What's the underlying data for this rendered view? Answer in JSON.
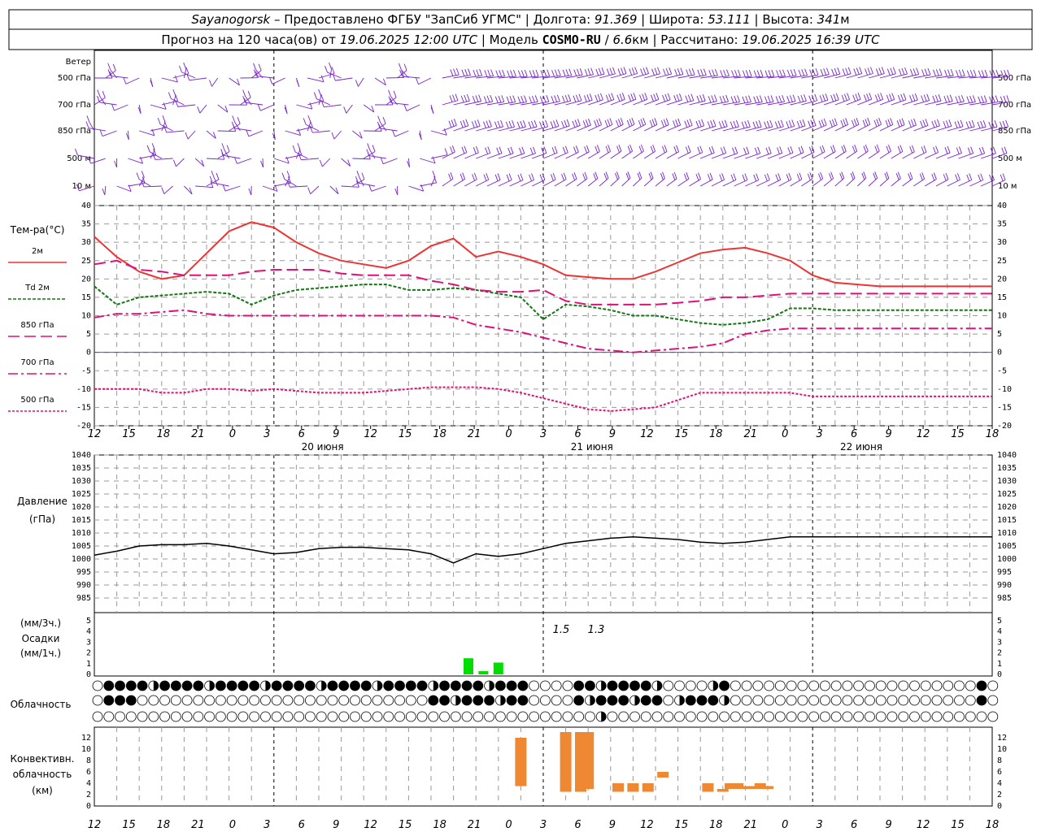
{
  "header": {
    "row1": [
      {
        "text": "Sayanogorsk",
        "style": "italic"
      },
      {
        "text": " – Предоставлено ФГБУ \"ЗапСиб УГМС\" | Долгота: ",
        "style": "normal"
      },
      {
        "text": "91.369",
        "style": "italic"
      },
      {
        "text": " | Широта: ",
        "style": "normal"
      },
      {
        "text": "53.111",
        "style": "italic"
      },
      {
        "text": " | Высота: ",
        "style": "normal"
      },
      {
        "text": "341",
        "style": "italic"
      },
      {
        "text": "м",
        "style": "normal"
      }
    ],
    "row2": [
      {
        "text": "Прогноз на 120 часа(ов) от ",
        "style": "normal"
      },
      {
        "text": "19.06.2025 12:00 UTC",
        "style": "italic"
      },
      {
        "text": "  | Модель ",
        "style": "normal"
      },
      {
        "text": "COSMO-RU",
        "style": "bold"
      },
      {
        "text": " / ",
        "style": "normal"
      },
      {
        "text": "6.6",
        "style": "italic"
      },
      {
        "text": "км | Рассчитано: ",
        "style": "normal"
      },
      {
        "text": "19.06.2025 16:39 UTC",
        "style": "italic"
      }
    ]
  },
  "hour_ticks": [
    "12",
    "15",
    "18",
    "21",
    "0",
    "3",
    "6",
    "9",
    "12",
    "15",
    "18",
    "21",
    "0",
    "3",
    "6",
    "9",
    "12",
    "15",
    "18",
    "21",
    "0",
    "3",
    "6",
    "9",
    "12",
    "15",
    "18"
  ],
  "day_labels": [
    "20 июня",
    "21 июня",
    "22 июня"
  ],
  "wind_panel": {
    "title": "Ветер",
    "levels": [
      "500 гПа",
      "700 гПа",
      "850 гПа",
      "500 м",
      "10 м"
    ],
    "color": "#7722cc"
  },
  "temp_panel": {
    "title": "Тем-ра(°С)",
    "legend": [
      {
        "label": "2м",
        "color": "#ee3333",
        "dash": ""
      },
      {
        "label": "Td 2м",
        "color": "#117711",
        "dash": "4,2"
      },
      {
        "label": "850 гПа",
        "color": "#dd1177",
        "dash": "14,6"
      },
      {
        "label": "700 гПа",
        "color": "#dd1177",
        "dash": "12,4,3,4"
      },
      {
        "label": "500 гПа",
        "color": "#dd1177",
        "dash": "3,2"
      }
    ],
    "yticks": [
      "40",
      "35",
      "30",
      "25",
      "20",
      "15",
      "10",
      "5",
      "0",
      "-5",
      "-10",
      "-15",
      "-20"
    ]
  },
  "pressure_panel": {
    "title_line1": "Давление",
    "title_line2": "(гПа)",
    "yticks": [
      "1040",
      "1035",
      "1030",
      "1025",
      "1020",
      "1015",
      "1010",
      "1005",
      "1000",
      "995",
      "990",
      "985"
    ]
  },
  "precip_panel": {
    "label1": "(мм/3ч.)",
    "label2": "Осадки",
    "label3": "(мм/1ч.)",
    "yticks": [
      "5",
      "4",
      "3",
      "2",
      "1",
      "0"
    ],
    "annot1": "1.5",
    "annot2": "1.3"
  },
  "cloud_panel": {
    "label": "Облачность"
  },
  "conv_panel": {
    "label1": "Конвективн.",
    "label2": "облачность",
    "label3": "(км)",
    "yticks": [
      "12",
      "10",
      "8",
      "6",
      "4",
      "2",
      "0"
    ]
  },
  "chart_data": [
    {
      "type": "line",
      "title": "Тем-ра(°С)",
      "x_hours_from_start": [
        0,
        3,
        6,
        9,
        12,
        15,
        18,
        21,
        24,
        27,
        30,
        33,
        36,
        39,
        42,
        45,
        48,
        51,
        54,
        57,
        60,
        63,
        66,
        69,
        72,
        75,
        78,
        81,
        84,
        87,
        90,
        93,
        96,
        99,
        102,
        105,
        108,
        111,
        114,
        117,
        120
      ],
      "ylim": [
        -20,
        40
      ],
      "series": [
        {
          "name": "2м",
          "color": "#ee3333",
          "dash": "",
          "values": [
            31.5,
            26,
            22,
            20,
            21,
            27,
            33,
            35.5,
            34,
            30,
            27,
            25,
            24,
            23,
            25,
            29,
            31,
            26,
            27.5,
            26,
            24,
            21,
            20.5,
            20,
            20,
            22,
            24.5,
            27,
            28,
            28.5,
            27,
            25,
            21,
            19,
            18.5,
            18,
            18,
            18,
            18,
            18,
            18
          ]
        },
        {
          "name": "Td 2м",
          "color": "#117711",
          "dash": "4,2",
          "values": [
            18,
            13,
            15,
            15.5,
            16,
            16.5,
            16,
            13,
            15.5,
            17,
            17.5,
            18,
            18.5,
            18.5,
            17,
            17,
            17.5,
            17,
            16,
            15,
            9,
            13,
            12.5,
            11.5,
            10,
            10,
            9,
            8,
            7.5,
            8,
            9,
            12,
            12,
            11.5,
            11.5,
            11.5,
            11.5,
            11.5,
            11.5,
            11.5,
            11.5
          ]
        },
        {
          "name": "850 гПа",
          "color": "#dd1177",
          "dash": "14,6",
          "values": [
            24,
            25,
            22.5,
            22,
            21,
            21,
            21,
            22,
            22.5,
            22.5,
            22.5,
            21.5,
            21,
            21,
            21,
            19.5,
            18.5,
            17,
            16.5,
            16.5,
            17,
            14,
            13,
            13,
            13,
            13,
            13.5,
            14,
            15,
            15,
            15.5,
            16,
            16,
            16,
            16,
            16,
            16,
            16,
            16,
            16,
            16
          ]
        },
        {
          "name": "700 гПа",
          "color": "#dd1177",
          "dash": "12,4,3,4",
          "values": [
            9.5,
            10.5,
            10.5,
            11,
            11.5,
            10.5,
            10,
            10,
            10,
            10,
            10,
            10,
            10,
            10,
            10,
            10,
            9.5,
            7.5,
            6.5,
            5.5,
            4,
            2.5,
            1,
            0.5,
            0,
            0.5,
            1,
            1.5,
            2.5,
            5,
            6,
            6.5,
            6.5,
            6.5,
            6.5,
            6.5,
            6.5,
            6.5,
            6.5,
            6.5,
            6.5
          ]
        },
        {
          "name": "500 гПа",
          "color": "#dd1177",
          "dash": "3,2",
          "values": [
            -10,
            -10,
            -10,
            -11,
            -11,
            -10,
            -10,
            -10.5,
            -10,
            -10.5,
            -11,
            -11,
            -11,
            -10.5,
            -10,
            -9.5,
            -9.5,
            -9.5,
            -10,
            -11,
            -12.5,
            -14,
            -15.5,
            -16,
            -15.5,
            -15,
            -13,
            -11,
            -11,
            -11,
            -11,
            -11,
            -12,
            -12,
            -12,
            -12,
            -12,
            -12,
            -12,
            -12,
            -12
          ]
        }
      ]
    },
    {
      "type": "line",
      "title": "Давление (гПа)",
      "x_hours_from_start": [
        0,
        3,
        6,
        9,
        12,
        15,
        18,
        21,
        24,
        27,
        30,
        33,
        36,
        39,
        42,
        45,
        48,
        51,
        54,
        57,
        60,
        63,
        66,
        69,
        72,
        75,
        78,
        81,
        84,
        87,
        90,
        93,
        96,
        99,
        102,
        105,
        108,
        111,
        114,
        117,
        120
      ],
      "ylim": [
        985,
        1040
      ],
      "series": [
        {
          "name": "Давление",
          "color": "#000000",
          "values": [
            1001.5,
            1003,
            1005,
            1005.5,
            1005.5,
            1006,
            1005,
            1003.5,
            1002,
            1002.5,
            1004,
            1004.5,
            1004.5,
            1004,
            1003.5,
            1002,
            998.5,
            1002,
            1001,
            1002,
            1004,
            1006,
            1007,
            1008,
            1008.5,
            1008,
            1007.5,
            1006.5,
            1006,
            1006.5,
            1007.5,
            1008.5,
            1008.5,
            1008.5,
            1008.5,
            1008.5,
            1008.5,
            1008.5,
            1008.5,
            1008.5,
            1008.5
          ]
        }
      ]
    },
    {
      "type": "bar",
      "title": "Осадки (мм/3ч.)",
      "x_hours_from_start": [
        50,
        52,
        54
      ],
      "ylim": [
        0,
        5
      ],
      "values": [
        1.5,
        0.3,
        1.1
      ],
      "color": "#00dd00",
      "annotations": [
        "1.5",
        "1.3"
      ]
    },
    {
      "type": "bar",
      "title": "Конвективн. облачность (км)",
      "x_hours_from_start": [
        57,
        63,
        65,
        66,
        68,
        70,
        72,
        74,
        76,
        82,
        84,
        85,
        86,
        87,
        88,
        89,
        90
      ],
      "bottoms": [
        3.5,
        2.5,
        2.5,
        3,
        2,
        2.5,
        2.5,
        2.5,
        5,
        2.5,
        2.5,
        3,
        3,
        3,
        3,
        3,
        3
      ],
      "tops": [
        12,
        13,
        13,
        13,
        2,
        4,
        4,
        4,
        6,
        4,
        3,
        4,
        4,
        3.5,
        3.5,
        4,
        3.5
      ],
      "ylim": [
        0,
        13
      ],
      "color": "#ee8833"
    }
  ]
}
